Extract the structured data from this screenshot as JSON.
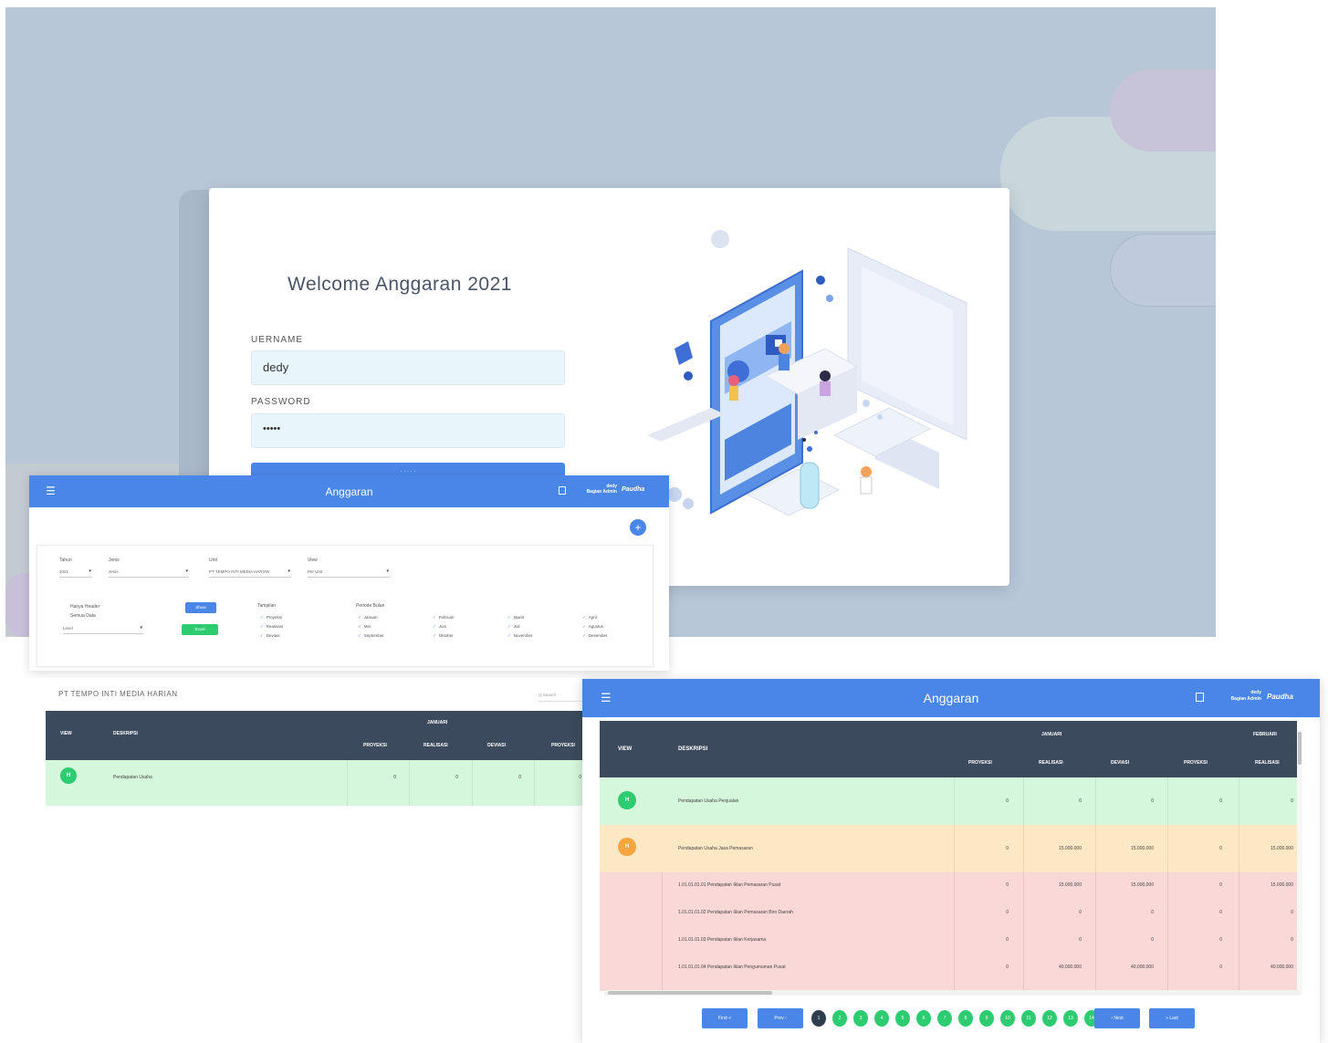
{
  "login": {
    "welcome_title": "Welcome Anggaran 2021",
    "username_label": "UERNAME",
    "username_value": "dedy",
    "password_label": "PASSWORD",
    "password_value": "•••••",
    "login_button": "· · · · ·"
  },
  "app1": {
    "title": "Anggaran",
    "user_name": "dedy",
    "user_role": "Bagian Admin",
    "brand": "Paudha",
    "fab_icon": "+",
    "filters": {
      "tahun_label": "Tahun",
      "tahun_value": "2021",
      "jenis_label": "Jenis",
      "jenis_value": "Jenis",
      "unit_label": "Unit",
      "unit_value": "PT TEMPO INTI MEDIA HARIAN",
      "view_label": "View",
      "view_value": "Per Unit",
      "option_line1": "Hanya Header",
      "option_line2": "Semua Data",
      "level_value": "Level",
      "show_button": "Show",
      "export_button": "Excel",
      "tampilan_label": "Tampilan",
      "tampilan_items": [
        "Proyeksi",
        "Realisasi",
        "Deviasi"
      ],
      "periode_label": "Periode Bulan",
      "months_col1": [
        "Januari",
        "Mei",
        "September"
      ],
      "months_col2": [
        "Februari",
        "Juni",
        "Oktober"
      ],
      "months_col3": [
        "Maret",
        "Juli",
        "November"
      ],
      "months_col4": [
        "April",
        "Agustus",
        "Desember"
      ]
    }
  },
  "table1": {
    "company": "PT TEMPO INTI MEDIA HARIAN",
    "search_placeholder": "Q Search",
    "headers": {
      "view": "VIEW",
      "deskripsi": "DESKRIPSI",
      "month": "JANUARI",
      "proyeksi": "PROYEKSI",
      "realisasi": "REALISASI",
      "deviasi": "DEVIASI",
      "next": "PROYEKSI"
    },
    "row": {
      "badge": "H",
      "desc": "Pendapatan Usaha",
      "values": [
        "0",
        "0",
        "0",
        "0"
      ]
    }
  },
  "app2": {
    "title": "Anggaran",
    "user_name": "dedy",
    "user_role": "Bagian Admin",
    "brand": "Paudha",
    "table": {
      "headers": {
        "view": "VIEW",
        "deskripsi": "DESKRIPSI",
        "month1": "JANUARI",
        "month2": "FEBRUARI",
        "proyeksi": "PROYEKSI",
        "realisasi": "REALISASI",
        "deviasi": "DEVIASI"
      },
      "rows": [
        {
          "badge": "H",
          "desc": "Pendapatan Usaha Penjualan",
          "values": [
            "0",
            "0",
            "0",
            "0",
            "0"
          ]
        },
        {
          "badge": "H",
          "desc": "Pendapatan Usaha Jasa Pemasaran",
          "values": [
            "0",
            "15.000.000",
            "15.000.000",
            "0",
            "15.000.000"
          ]
        },
        {
          "desc": "1.01.01.01.01 Pendapatan Iklan Pemasaran Pusat",
          "values": [
            "0",
            "15.000.000",
            "15.000.000",
            "0",
            "15.000.000"
          ]
        },
        {
          "desc": "1.01.01.01.02 Pendapatan Iklan Pemasaran Biro Daerah",
          "values": [
            "0",
            "0",
            "0",
            "0",
            "0"
          ]
        },
        {
          "desc": "1.01.01.01.03 Pendapatan Iklan Kerjasama",
          "values": [
            "0",
            "0",
            "0",
            "0",
            "0"
          ]
        },
        {
          "desc": "1.01.01.01.04 Pendapatan Iklan Pengumuman Pusat",
          "values": [
            "0",
            "40.000.000",
            "40.000.000",
            "0",
            "40.000.000"
          ]
        }
      ]
    },
    "pager": {
      "first": "First",
      "prev": "Prev",
      "pages": [
        "1",
        "2",
        "3",
        "4",
        "5",
        "6",
        "7",
        "8",
        "9",
        "10",
        "11",
        "12",
        "13",
        "14"
      ],
      "active_page": "1",
      "next": "Next",
      "last": "Last"
    }
  },
  "colors": {
    "topbar": "#4a86e8",
    "table_header": "#3b4a5c",
    "row_green": "#d5f7dc",
    "row_orange": "#fde8c5",
    "row_red": "#fbd8d8",
    "badge_green": "#2ecc71",
    "badge_orange": "#f5a442"
  }
}
